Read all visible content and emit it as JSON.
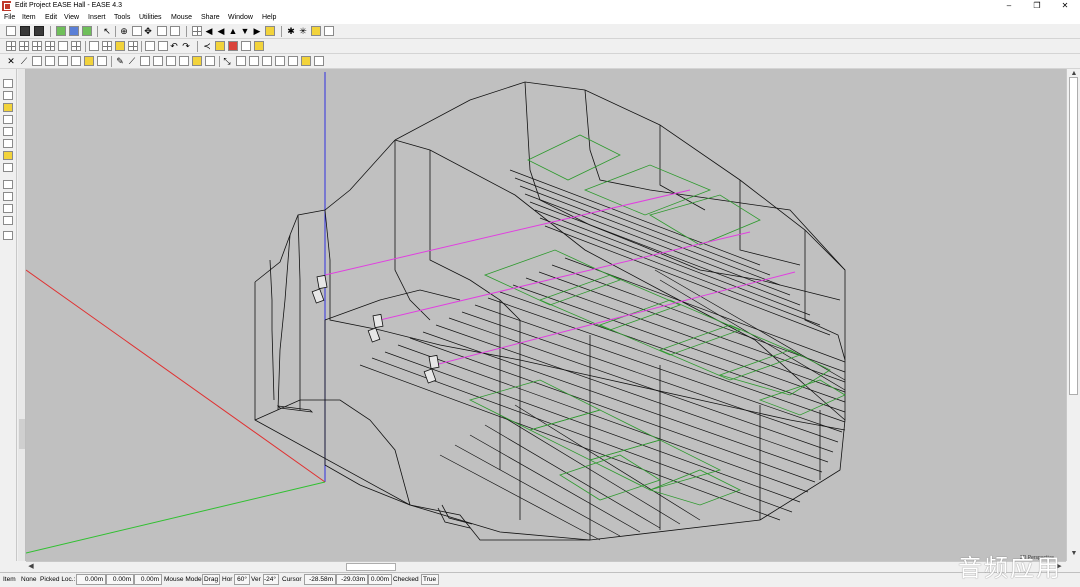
{
  "window": {
    "title": "Edit Project EASE Hall - EASE 4.3",
    "controls": {
      "minimize": "–",
      "restore": "❐",
      "close": "✕"
    }
  },
  "menu": [
    "File",
    "Item",
    "Edit",
    "View",
    "Insert",
    "Tools",
    "Utilities",
    "Mouse",
    "Share",
    "Window",
    "Help"
  ],
  "viewport": {
    "background": "#c0c0c0",
    "axis_colors": {
      "x": "#e03030",
      "y": "#30c030",
      "z": "#3030e0"
    },
    "wire_color": "#111111",
    "audience_area_color": "#2e9a2e",
    "ray_color": "#e040e0",
    "view_label": "3D Perspective"
  },
  "status": {
    "item_label": "Item",
    "item_value": "None",
    "picked_label": "Picked Loc.:",
    "picked_x": "0.00m",
    "picked_y": "0.00m",
    "picked_z": "0.00m",
    "mouse_mode_label": "Mouse Mode",
    "mouse_mode_value": "Drag",
    "hor_label": "Hor",
    "hor_value": "60°",
    "ver_label": "Ver",
    "ver_value": "-24°",
    "cursor_label": "Cursor",
    "cursor_x": "-28.58m",
    "cursor_y": "-29.03m",
    "cursor_z": "0.00m",
    "checked_label": "Checked",
    "checked_value": "True"
  },
  "watermark": "音频应用"
}
